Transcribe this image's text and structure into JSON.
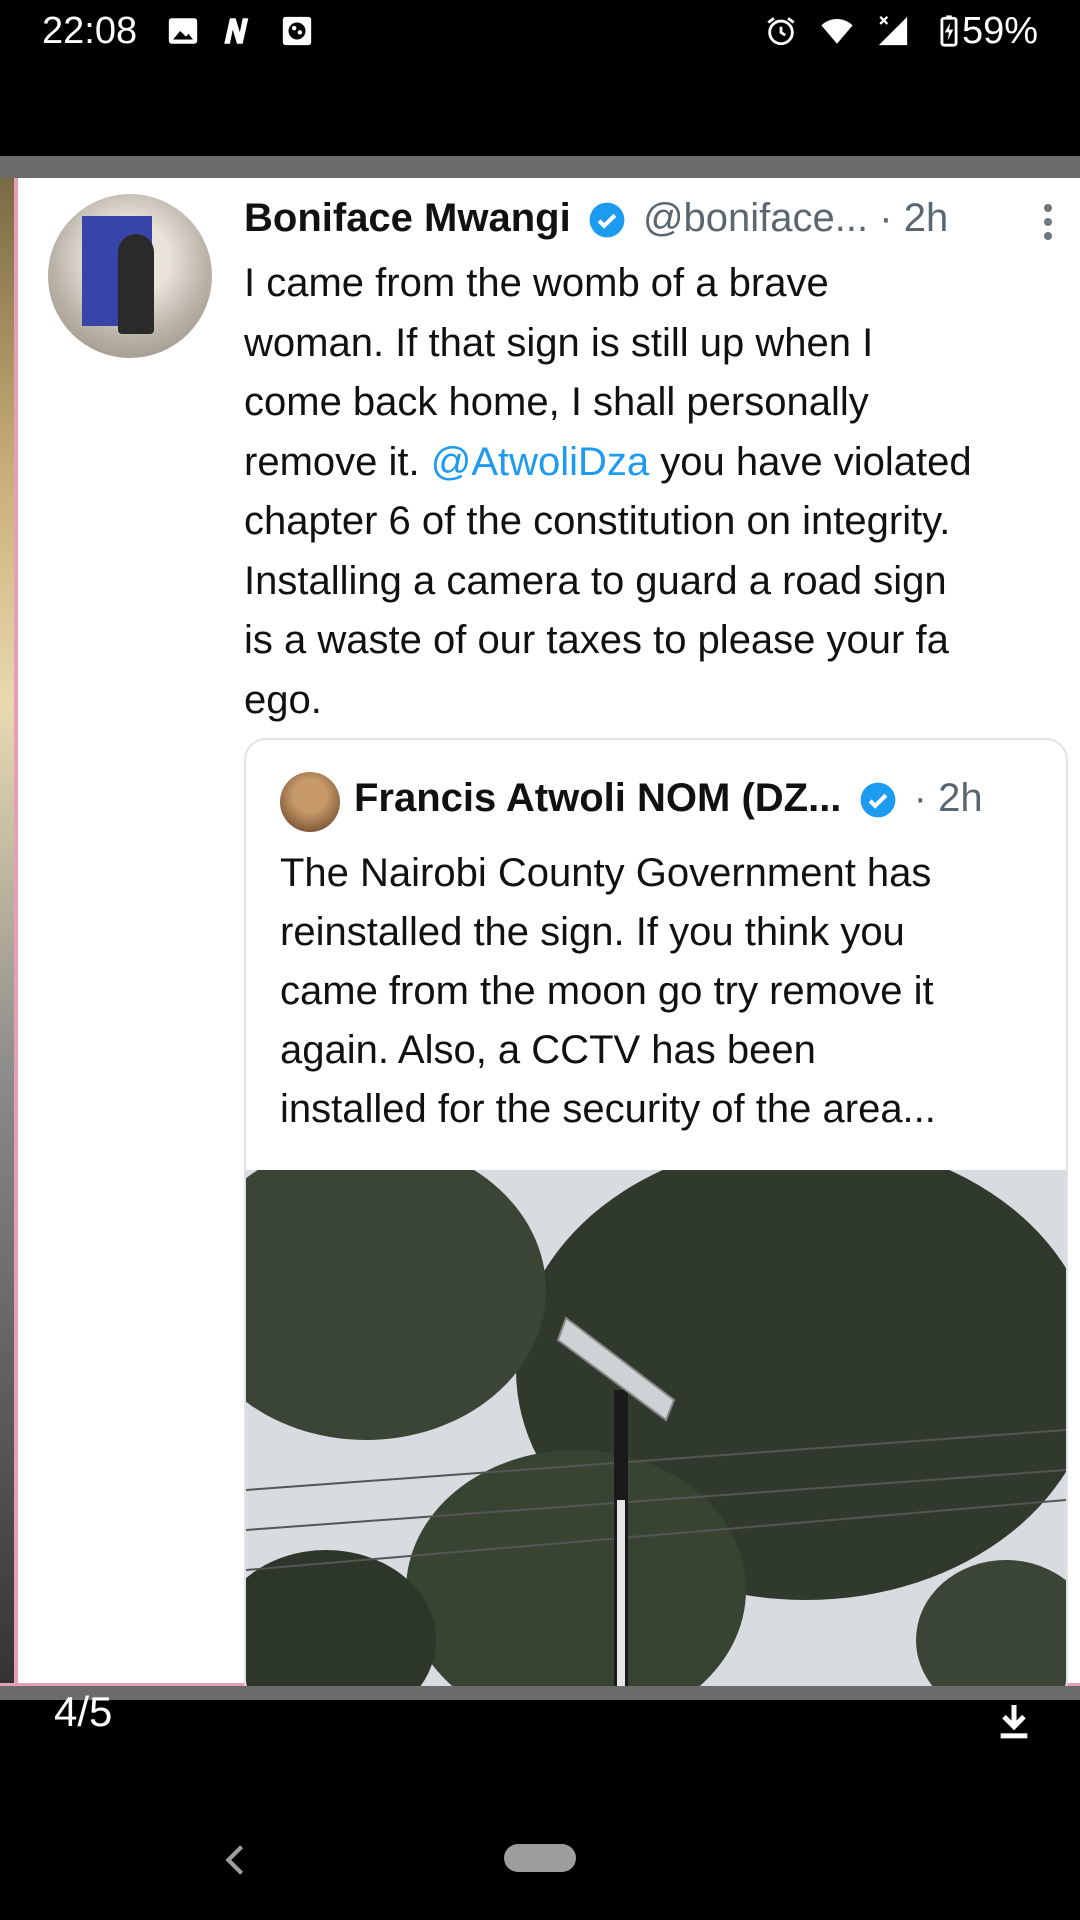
{
  "status_bar": {
    "time": "22:08",
    "battery": "59%",
    "notification_icons": [
      "gallery-icon",
      "n-app-icon",
      "game-icon"
    ],
    "system_icons": [
      "alarm-icon",
      "wifi-icon",
      "signal-icon",
      "battery-charging-icon"
    ]
  },
  "tweet": {
    "name": "Boniface Mwangi",
    "handle": "@boniface...",
    "time": "· 2h",
    "text_part1": "I came from the womb of a brave\nwoman. If that sign is still up when I\ncome back home, I shall personally\nremove it. ",
    "mention": "@AtwoliDza",
    "text_part2": " you have violated\nchapter 6 of the constitution on integrity.\nInstalling a camera to guard a road sign\nis a waste of our taxes to please your fa\nego."
  },
  "quote": {
    "name": "Francis Atwoli NOM (DZ...",
    "time": "· 2h",
    "text": "The Nairobi County Government has\nreinstalled the sign. If you think you\ncame from the moon go try remove it\nagain. Also, a CCTV has been\ninstalled for the security of the area..."
  },
  "viewer": {
    "counter": "4/5"
  },
  "colors": {
    "link": "#1d9bf0",
    "verified": "#1d9bf0"
  }
}
